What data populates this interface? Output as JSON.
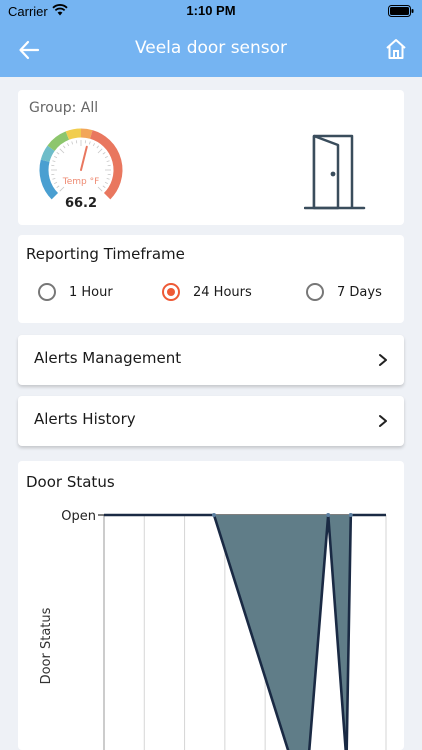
{
  "status_bar": {
    "carrier": "Carrier",
    "time": "1:10 PM"
  },
  "nav": {
    "title": "Veela door sensor",
    "back_icon": "arrow-left-icon",
    "home_icon": "home-icon"
  },
  "sensor_card": {
    "group_label": "Group: All",
    "gauge": {
      "label": "Temp °F",
      "value": "66.2",
      "numeric_value": 66.2,
      "min": 0,
      "max": 120
    },
    "icon": "open-door-icon"
  },
  "reporting": {
    "title": "Reporting Timeframe",
    "options": [
      {
        "label": "1 Hour",
        "selected": false
      },
      {
        "label": "24 Hours",
        "selected": true
      },
      {
        "label": "7 Days",
        "selected": false
      }
    ],
    "accent_color": "#ee5a36"
  },
  "menu_rows": [
    {
      "label": "Alerts Management"
    },
    {
      "label": "Alerts History"
    }
  ],
  "chart_data": {
    "type": "area",
    "title": "Door Status",
    "ylabel": "Door Status",
    "xlabel": "",
    "y_ticks": [
      "Open"
    ],
    "x": [
      0,
      0.39,
      0.665,
      0.725,
      0.795,
      0.86,
      0.875,
      1.0
    ],
    "values": [
      1,
      1,
      0,
      0,
      1,
      0,
      1,
      1
    ],
    "fill_color": "#607d88",
    "line_color": "#1a2a44"
  },
  "colors": {
    "header": "#75b4f2",
    "background": "#eef1f6"
  }
}
